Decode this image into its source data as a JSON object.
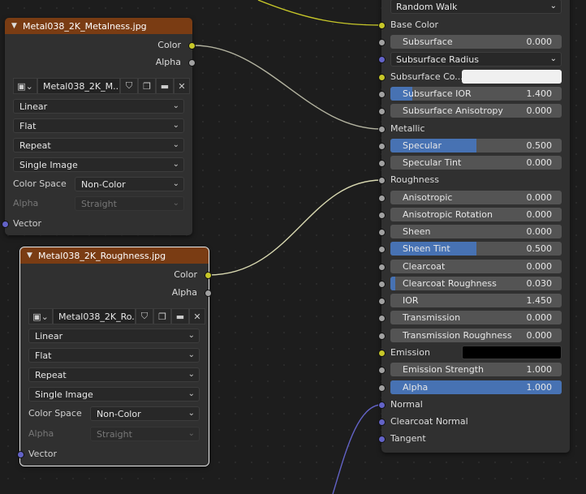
{
  "colors": {
    "background": "#1d1d1d",
    "node_body": "#303030",
    "texture_header": "#7a3c13",
    "socket_color": "#c7c729",
    "socket_float": "#a1a1a1",
    "socket_vector": "#6363c7",
    "slider_fill": "#4772b3"
  },
  "metal_node": {
    "title": "Metal038_2K_Metalness.jpg",
    "output_color": "Color",
    "output_alpha": "Alpha",
    "image_name": "Metal038_2K_M...",
    "interpolation": "Linear",
    "projection": "Flat",
    "extension": "Repeat",
    "source": "Single Image",
    "color_space_label": "Color Space",
    "color_space": "Non-Color",
    "alpha_label": "Alpha",
    "alpha_mode": "Straight",
    "input_vector": "Vector"
  },
  "rough_node": {
    "title": "Metal038_2K_Roughness.jpg",
    "output_color": "Color",
    "output_alpha": "Alpha",
    "image_name": "Metal038_2K_Ro...",
    "interpolation": "Linear",
    "projection": "Flat",
    "extension": "Repeat",
    "source": "Single Image",
    "color_space_label": "Color Space",
    "color_space": "Non-Color",
    "alpha_label": "Alpha",
    "alpha_mode": "Straight",
    "input_vector": "Vector"
  },
  "bsdf": {
    "subsurface_method": "Random Walk",
    "base_color": "Base Color",
    "subsurface": {
      "name": "Subsurface",
      "value": "0.000",
      "fill": 0
    },
    "subsurface_radius": "Subsurface Radius",
    "subsurface_color_label": "Subsurface Co...",
    "subsurface_color": "#f0f0f0",
    "subsurface_ior": {
      "name": "Subsurface IOR",
      "value": "1.400",
      "fill": 0.13
    },
    "subsurface_anisotropy": {
      "name": "Subsurface Anisotropy",
      "value": "0.000",
      "fill": 0
    },
    "metallic": "Metallic",
    "specular": {
      "name": "Specular",
      "value": "0.500",
      "fill": 0.5
    },
    "specular_tint": {
      "name": "Specular Tint",
      "value": "0.000",
      "fill": 0
    },
    "roughness": "Roughness",
    "anisotropic": {
      "name": "Anisotropic",
      "value": "0.000",
      "fill": 0
    },
    "anisotropic_rotation": {
      "name": "Anisotropic Rotation",
      "value": "0.000",
      "fill": 0
    },
    "sheen": {
      "name": "Sheen",
      "value": "0.000",
      "fill": 0
    },
    "sheen_tint": {
      "name": "Sheen Tint",
      "value": "0.500",
      "fill": 0.5
    },
    "clearcoat": {
      "name": "Clearcoat",
      "value": "0.000",
      "fill": 0
    },
    "clearcoat_roughness": {
      "name": "Clearcoat Roughness",
      "value": "0.030",
      "fill": 0.03
    },
    "ior": {
      "name": "IOR",
      "value": "1.450",
      "fill": 0
    },
    "transmission": {
      "name": "Transmission",
      "value": "0.000",
      "fill": 0
    },
    "transmission_roughness": {
      "name": "Transmission Roughness",
      "value": "0.000",
      "fill": 0
    },
    "emission": "Emission",
    "emission_color": "#000000",
    "emission_strength": {
      "name": "Emission Strength",
      "value": "1.000",
      "fill": 0
    },
    "alpha": {
      "name": "Alpha",
      "value": "1.000",
      "fill": 1
    },
    "normal": "Normal",
    "clearcoat_normal": "Clearcoat Normal",
    "tangent": "Tangent"
  }
}
